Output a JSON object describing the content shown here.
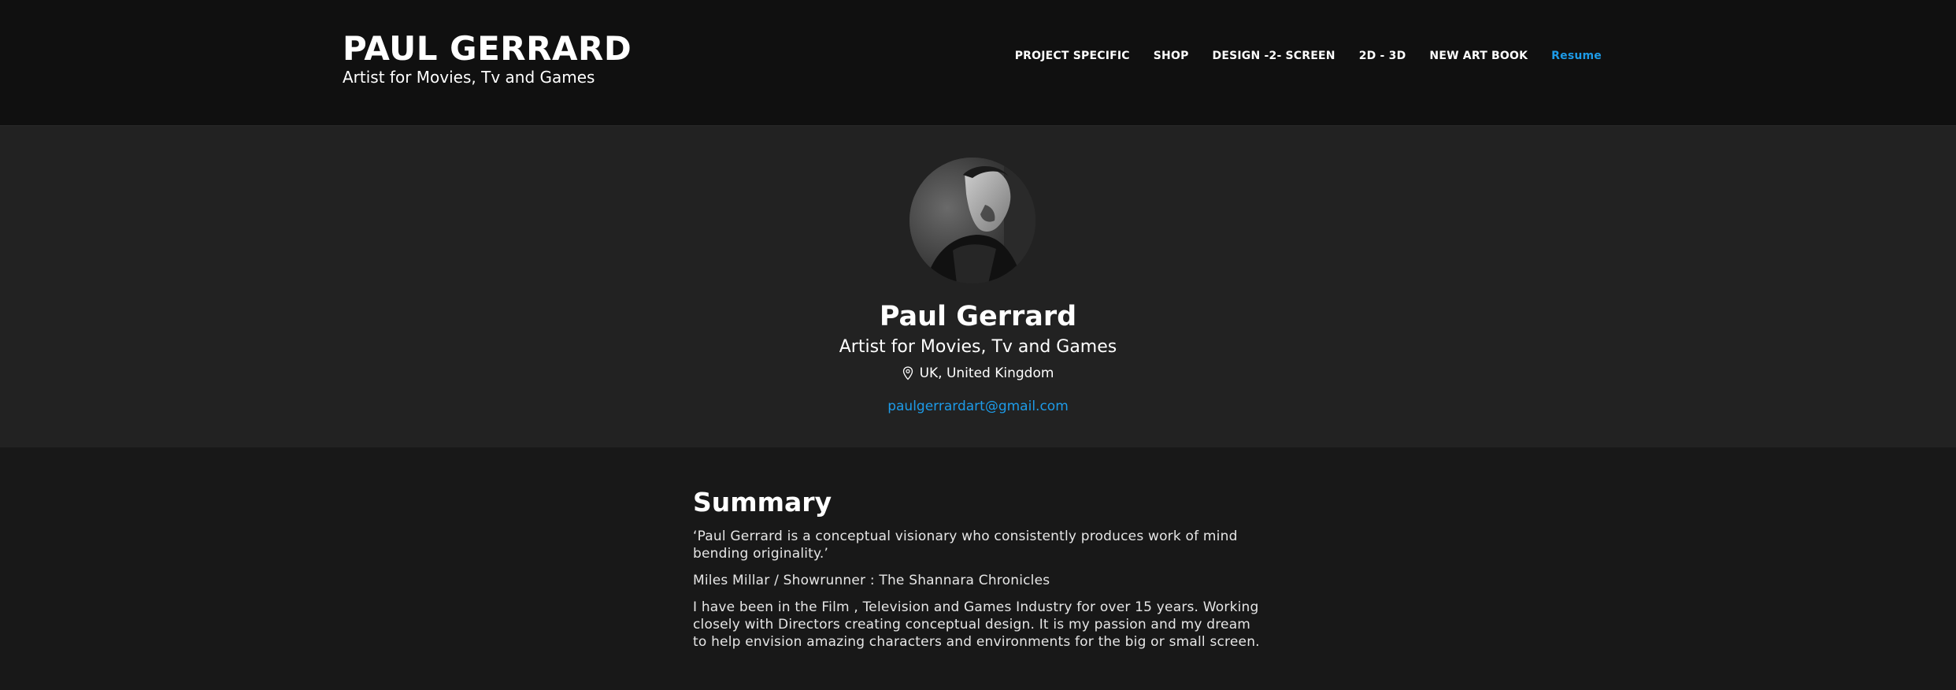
{
  "header": {
    "title": "PAUL GERRARD",
    "tagline": "Artist for Movies, Tv and Games",
    "nav": [
      {
        "label": "PROJECT SPECIFIC"
      },
      {
        "label": "SHOP"
      },
      {
        "label": "DESIGN -2- SCREEN"
      },
      {
        "label": "2D - 3D"
      },
      {
        "label": "NEW ART BOOK"
      },
      {
        "label": "Resume"
      }
    ],
    "active_nav": "Resume"
  },
  "profile": {
    "name": "Paul Gerrard",
    "role": "Artist for Movies, Tv and Games",
    "location": "UK, United Kingdom",
    "location_icon": "map-pin-icon",
    "email": "paulgerrardart@gmail.com"
  },
  "summary": {
    "heading": "Summary",
    "paragraphs": [
      "‘Paul Gerrard is a conceptual visionary who consistently produces work of mind bending originality.’",
      "Miles Millar / Showrunner : The Shannara Chronicles",
      "I have been in the Film , Television and Games Industry for over 15 years. Working closely with Directors creating conceptual design. It is my passion and my dream to help envision amazing characters and environments for the big or small screen."
    ]
  },
  "colors": {
    "header_bg": "#101010",
    "profile_bg": "#222222",
    "page_bg": "#181818",
    "accent": "#1d9be8",
    "text": "#ffffff"
  }
}
